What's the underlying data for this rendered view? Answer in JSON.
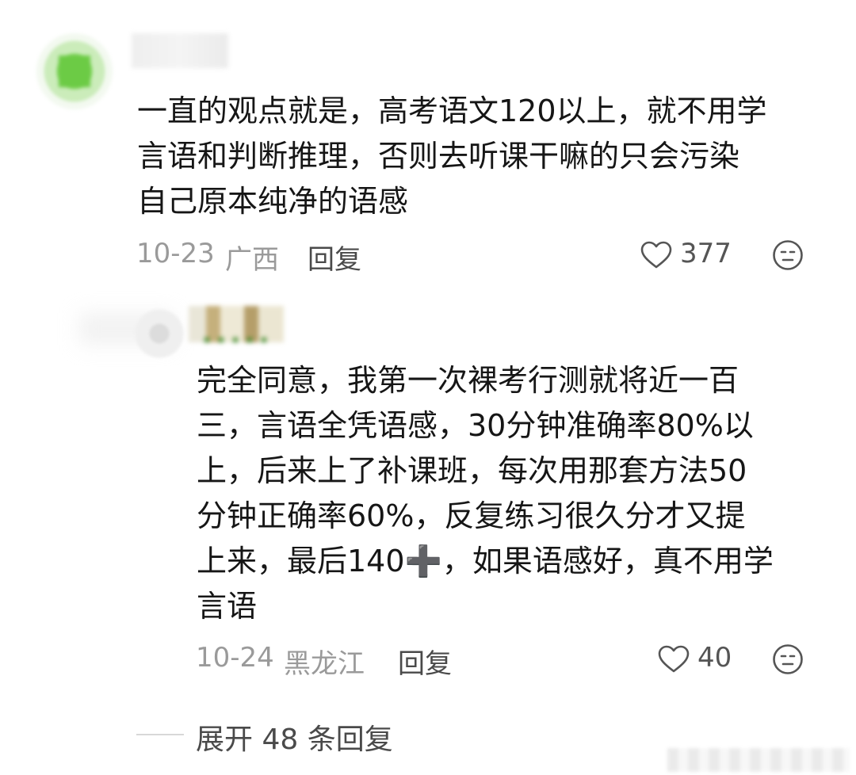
{
  "comments": [
    {
      "lines": [
        "一直的观点就是，高考语文120以上，就不用学",
        "言语和判断推理，否则去听课干嘛的只会污染",
        "自己原本纯净的语感"
      ],
      "date": "10-23",
      "location": "广西",
      "reply_label": "回复",
      "likes": "377"
    },
    {
      "lines": [
        "完全同意，我第一次裸考行测就将近一百",
        "三，言语全凭语感，30分钟准确率80%以",
        "上，后来上了补课班，每次用那套方法50",
        "分钟正确率60%，反复练习很久分才又提",
        "上来，最后140➕，如果语感好，真不用学",
        "言语"
      ],
      "date": "10-24",
      "location": "黑龙江",
      "reply_label": "回复",
      "likes": "40"
    }
  ],
  "expand_replies_label": "展开 48 条回复",
  "icons": {
    "like": "heart-icon",
    "reaction": "emoji-face-icon"
  },
  "colors": {
    "meta_gray": "#9a9a9a",
    "text": "#161616"
  }
}
